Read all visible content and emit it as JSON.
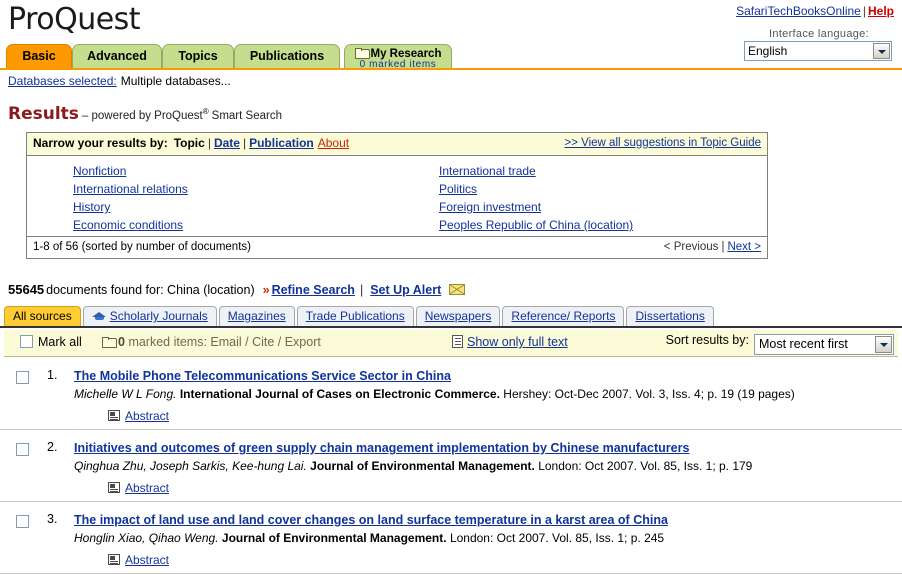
{
  "header": {
    "brand": "ProQuest",
    "user_link": "SafariTechBooksOnline",
    "separator": "|",
    "help_link": "Help",
    "language_label": "Interface language:",
    "language_value": "English"
  },
  "nav_tabs": [
    {
      "label": "Basic",
      "active": true
    },
    {
      "label": "Advanced",
      "active": false
    },
    {
      "label": "Topics",
      "active": false
    },
    {
      "label": "Publications",
      "active": false
    }
  ],
  "my_research": {
    "title": "My Research",
    "subtitle": "0 marked items"
  },
  "databases": {
    "label": "Databases selected:",
    "value": "Multiple databases..."
  },
  "results_title": {
    "main": "Results",
    "sub_before": "– powered by ProQuest",
    "sup": "®",
    "sub_after": "Smart Search"
  },
  "narrow_box": {
    "label": "Narrow your results by:",
    "topic": "Topic",
    "pipe": "|",
    "date_link": "Date",
    "publication_link": "Publication",
    "about_link": "About",
    "view_all": ">> View all suggestions in Topic Guide",
    "left_links": [
      "Nonfiction",
      "International relations",
      "History",
      "Economic conditions"
    ],
    "right_links": [
      "International trade",
      "Politics",
      "Foreign investment",
      "Peoples Republic of China (location)"
    ],
    "footer_range": "1-8 of 56 (sorted by number of documents)",
    "prev_label": "< Previous",
    "paging_sep": "|",
    "next_label": "Next >"
  },
  "found_line": {
    "count": "55645",
    "text": "documents found for: China (location)",
    "arrows": "»",
    "refine_link": "Refine Search",
    "pipe": "|",
    "alert_link": "Set Up Alert"
  },
  "source_tabs": [
    {
      "label": "All sources",
      "active": true,
      "icon": ""
    },
    {
      "label": "Scholarly Journals",
      "active": false,
      "icon": "graduation-cap-icon"
    },
    {
      "label": "Magazines",
      "active": false,
      "icon": ""
    },
    {
      "label": "Trade Publications",
      "active": false,
      "icon": ""
    },
    {
      "label": "Newspapers",
      "active": false,
      "icon": ""
    },
    {
      "label": "Reference/ Reports",
      "active": false,
      "icon": ""
    },
    {
      "label": "Dissertations",
      "active": false,
      "icon": ""
    }
  ],
  "action_bar": {
    "mark_all": "Mark all",
    "marked_count": "0",
    "marked_text": "marked items: Email / Cite / Export",
    "full_text_link": "Show only full text",
    "sort_label": "Sort results by:",
    "sort_value": "Most recent first"
  },
  "results": [
    {
      "number": "1.",
      "title": "The Mobile Phone Telecommunications Service Sector in China",
      "authors": "Michelle W L Fong.",
      "publication": "International Journal of Cases on Electronic Commerce.",
      "details": "Hershey: Oct-Dec 2007. Vol. 3, Iss. 4; p. 19 (19 pages)",
      "abstract_label": "Abstract"
    },
    {
      "number": "2.",
      "title": "Initiatives and outcomes of green supply chain management implementation by Chinese manufacturers",
      "authors": "Qinghua Zhu, Joseph Sarkis, Kee-hung Lai.",
      "publication": "Journal of Environmental Management.",
      "details": "London: Oct 2007. Vol. 85, Iss. 1; p. 179",
      "abstract_label": "Abstract"
    },
    {
      "number": "3.",
      "title": "The impact of land use and land cover changes on land surface temperature in a karst area of China",
      "authors": "Honglin Xiao, Qihao Weng.",
      "publication": "Journal of Environmental Management.",
      "details": "London: Oct 2007. Vol. 85, Iss. 1; p. 245",
      "abstract_label": "Abstract"
    }
  ],
  "colors": {
    "accent_orange": "#ff9900",
    "tab_green": "#c5de8d",
    "active_source_tab": "#ffcc33",
    "link_blue": "#11339a",
    "help_red": "#cc0000",
    "results_maroon": "#8b1a1a",
    "panel_yellow": "#fcfbd8"
  }
}
